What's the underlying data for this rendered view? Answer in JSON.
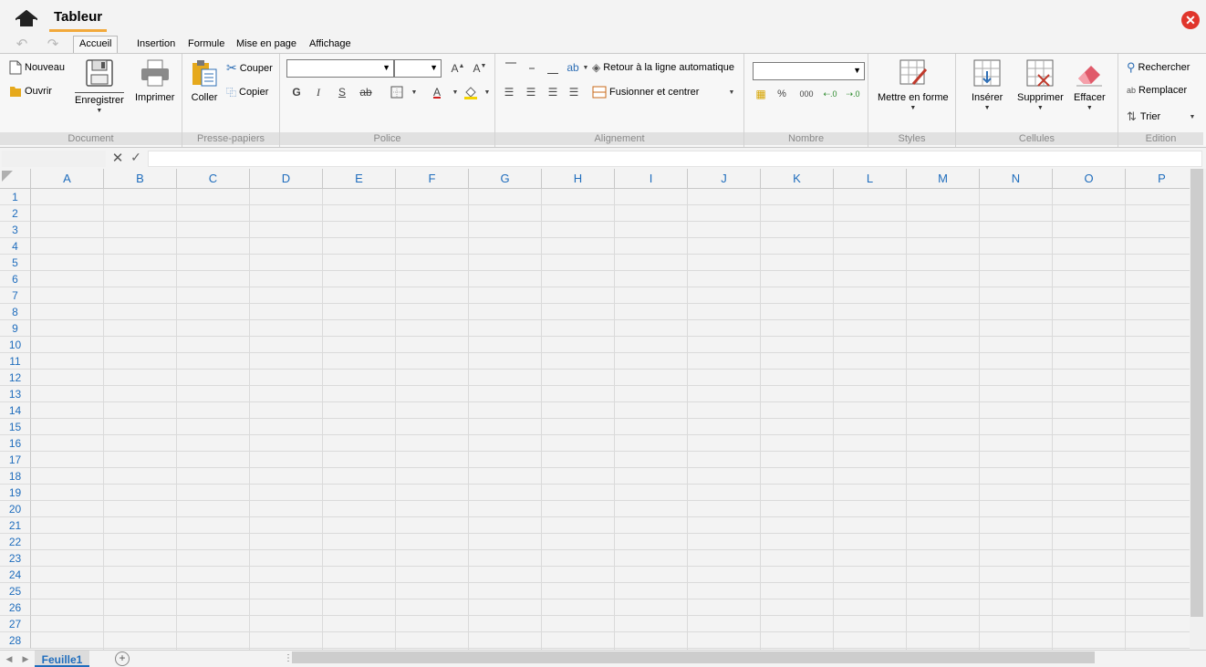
{
  "app": {
    "title": "Tableur"
  },
  "menu": {
    "tabs": [
      "Accueil",
      "Insertion",
      "Formule",
      "Mise en page",
      "Affichage"
    ],
    "active": "Accueil"
  },
  "ribbon": {
    "document": {
      "label": "Document",
      "nouveau": "Nouveau",
      "ouvrir": "Ouvrir",
      "enregistrer": "Enregistrer",
      "imprimer": "Imprimer"
    },
    "clipboard": {
      "label": "Presse-papiers",
      "coller": "Coller",
      "couper": "Couper",
      "copier": "Copier"
    },
    "font": {
      "label": "Police",
      "font_name": "",
      "font_size": "",
      "bold": "G",
      "italic": "I",
      "underline": "S",
      "strike": "ab",
      "font_color": "A"
    },
    "alignment": {
      "label": "Alignement",
      "wrap": "Retour à la ligne automatique",
      "merge": "Fusionner et centrer"
    },
    "number": {
      "label": "Nombre",
      "format": "",
      "percent": "%",
      "thousands": "000"
    },
    "styles": {
      "label": "Styles",
      "format": "Mettre en forme"
    },
    "cells": {
      "label": "Cellules",
      "insert": "Insérer",
      "delete": "Supprimer",
      "clear": "Effacer"
    },
    "edition": {
      "label": "Edition",
      "search": "Rechercher",
      "replace": "Remplacer",
      "sort": "Trier"
    }
  },
  "formula": {
    "name_box": "",
    "value": ""
  },
  "grid": {
    "columns": [
      "A",
      "B",
      "C",
      "D",
      "E",
      "F",
      "G",
      "H",
      "I",
      "J",
      "K",
      "L",
      "M",
      "N",
      "O",
      "P"
    ],
    "rows": [
      "1",
      "2",
      "3",
      "4",
      "5",
      "6",
      "7",
      "8",
      "9",
      "10",
      "11",
      "12",
      "13",
      "14",
      "15",
      "16",
      "17",
      "18",
      "19",
      "20",
      "21",
      "22",
      "23",
      "24",
      "25",
      "26",
      "27",
      "28"
    ]
  },
  "sheets": {
    "tabs": [
      "Feuille1"
    ],
    "active": "Feuille1"
  },
  "colors": {
    "accent": "#1f6dbd",
    "title_underline": "#f2a93b",
    "close": "#e0352b"
  }
}
